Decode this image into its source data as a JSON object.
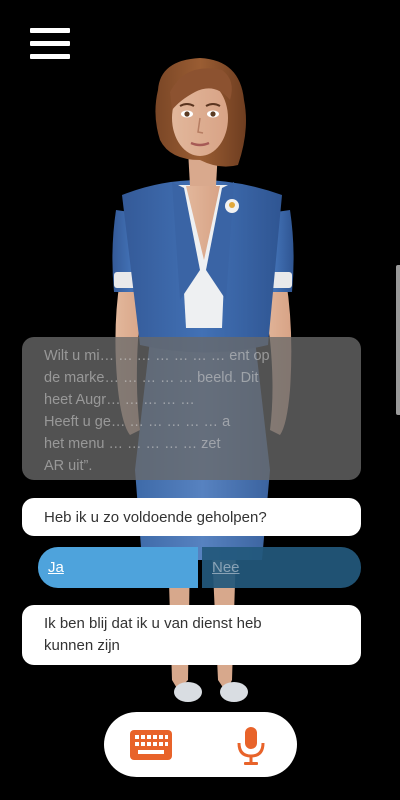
{
  "menu": {
    "icon": "hamburger-menu-icon"
  },
  "speech": {
    "lines": [
      "Wilt u mi… … … … … … … ent op",
      "de marke… … … … … beeld. Dit",
      "heet Augr… … … … …",
      "Heeft u ge… … … … … … a",
      "het menu … … … … … zet",
      "AR uit”."
    ]
  },
  "question": "Heb ik u zo voldoende geholpen?",
  "choices": {
    "yes": "Ja",
    "no": "Nee"
  },
  "answer": {
    "line1": "Ik ben blij dat ik u van dienst heb",
    "line2": "kunnen zijn"
  },
  "bottom": {
    "keyboard_icon": "keyboard-icon",
    "mic_icon": "microphone-icon"
  },
  "colors": {
    "accent_orange": "#e8632a",
    "choice_selected": "#4ea3dc",
    "choice_unselected": "#22587c",
    "jacket": "#3a64a5"
  }
}
